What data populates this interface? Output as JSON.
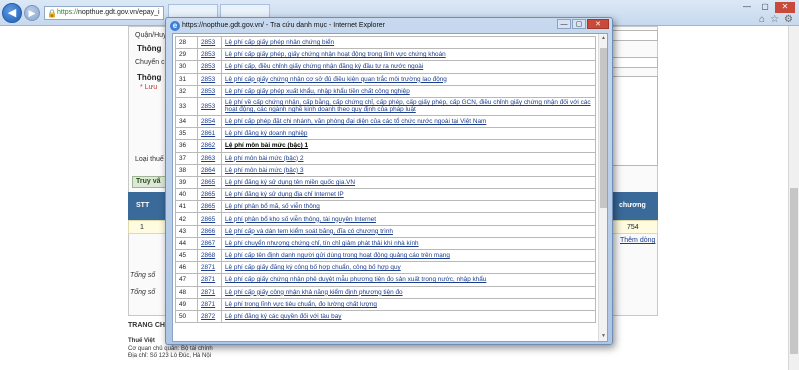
{
  "browser": {
    "address": "https://nopthue.gdt.gov.vn/epay_i",
    "address_scheme": "https://",
    "address_rest": "nopthue.gdt.gov.vn/epay_i"
  },
  "background": {
    "label_quan": "Quận/Huy",
    "section_thong1": "Thông",
    "label_chuyen": "Chuyển c",
    "section_thong2": "Thông",
    "label_luu": "* Lưu",
    "label_loai_thue": "Loại thuế",
    "tab_truy": "Truy vấ",
    "grid_stt": "STT",
    "grid_chuong": "chương",
    "row_stt": "1",
    "row_value": "754",
    "them_dong": "Thêm dòng",
    "tong1": "Tổng số",
    "tong2": "Tổng số",
    "footer_title": "TRANG CH",
    "footer_thue": "Thuế Việt",
    "footer_co_quan": "Cơ quan chủ quản: Bộ tài chính",
    "footer_dia_chi": "Địa chỉ: Số 123 Lò Đúc, Hà Nội"
  },
  "dialog": {
    "title": "https://nopthue.gdt.gov.vn/ - Tra cứu danh mục - Internet Explorer",
    "rows": [
      {
        "stt": "28",
        "code": "2853",
        "name": "Lệ phí cấp giấy phép nhân chứng biển"
      },
      {
        "stt": "29",
        "code": "2853",
        "name": "Lệ phí cấp giấy phép, giấy chứng nhận hoạt động trong lĩnh vực chứng khoán"
      },
      {
        "stt": "30",
        "code": "2853",
        "name": "Lệ phí cấp, điều chỉnh giấy chứng nhận đăng ký đầu tư ra nước ngoài"
      },
      {
        "stt": "31",
        "code": "2853",
        "name": "Lệ phí cấp giấy chứng nhận cơ sở đủ điều kiện quan trắc môi trường lao động"
      },
      {
        "stt": "32",
        "code": "2853",
        "name": "Lệ phí cấp giấy phép xuất khẩu, nhập khẩu tiền chất công nghiệp"
      },
      {
        "stt": "33",
        "code": "2853",
        "name": "Lệ phí về cấp chứng nhận, cấp bằng, cấp chứng chỉ, cấp phép, cấp giấy phép, cấp GCN, điều chỉnh giấy chứng nhận đối với các hoạt động, các ngành nghề kinh doanh theo quy định của pháp luật",
        "tall": true
      },
      {
        "stt": "34",
        "code": "2854",
        "name": "Lệ phí cấp phép đặt chi nhánh, văn phòng đại diện của các tổ chức nước ngoài tại Việt Nam"
      },
      {
        "stt": "35",
        "code": "2861",
        "name": "Lệ phí đăng ký doanh nghiệp"
      },
      {
        "stt": "36",
        "code": "2862",
        "name": "Lệ phí môn bài mức (bậc) 1",
        "bold": true
      },
      {
        "stt": "37",
        "code": "2863",
        "name": "Lệ phí môn bài mức (bậc) 2"
      },
      {
        "stt": "38",
        "code": "2864",
        "name": "Lệ phí môn bài mức (bậc) 3"
      },
      {
        "stt": "39",
        "code": "2865",
        "name": "Lệ phí đăng ký sử dụng tên miền quốc gia.VN"
      },
      {
        "stt": "40",
        "code": "2865",
        "name": "Lệ phí đăng ký sử dụng địa chỉ Internet IP"
      },
      {
        "stt": "41",
        "code": "2865",
        "name": "Lệ phí phân bổ mã, số viễn thông"
      },
      {
        "stt": "42",
        "code": "2865",
        "name": "Lệ phí phân bổ kho số viễn thông, tài nguyên Internet"
      },
      {
        "stt": "43",
        "code": "2866",
        "name": "Lệ phí cấp và dán tem kiểm soát băng, đĩa có chương trình"
      },
      {
        "stt": "44",
        "code": "2867",
        "name": "Lệ phí chuyển nhượng chứng chỉ, tín chỉ giảm phát thải khí nhà kính"
      },
      {
        "stt": "45",
        "code": "2868",
        "name": "Lệ phí cấp tên định danh người gửi dùng trong hoạt động quảng cáo trên mạng"
      },
      {
        "stt": "46",
        "code": "2871",
        "name": "Lệ phí cấp giấy đăng ký công bố hợp chuẩn, công bố hợp quy"
      },
      {
        "stt": "47",
        "code": "2871",
        "name": "Lệ phí cấp giấy chứng nhận phê duyệt mẫu phương tiện đo sản xuất trong nước, nhập khẩu"
      },
      {
        "stt": "48",
        "code": "2871",
        "name": "Lệ phí cấp giấy công nhận khả năng kiểm định phương tiện đo"
      },
      {
        "stt": "49",
        "code": "2871",
        "name": "Lệ phí trong lĩnh vực tiêu chuẩn, đo lường chất lượng"
      },
      {
        "stt": "50",
        "code": "2872",
        "name": "Lệ phí đăng ký các quyền đối với tàu bay"
      }
    ]
  }
}
